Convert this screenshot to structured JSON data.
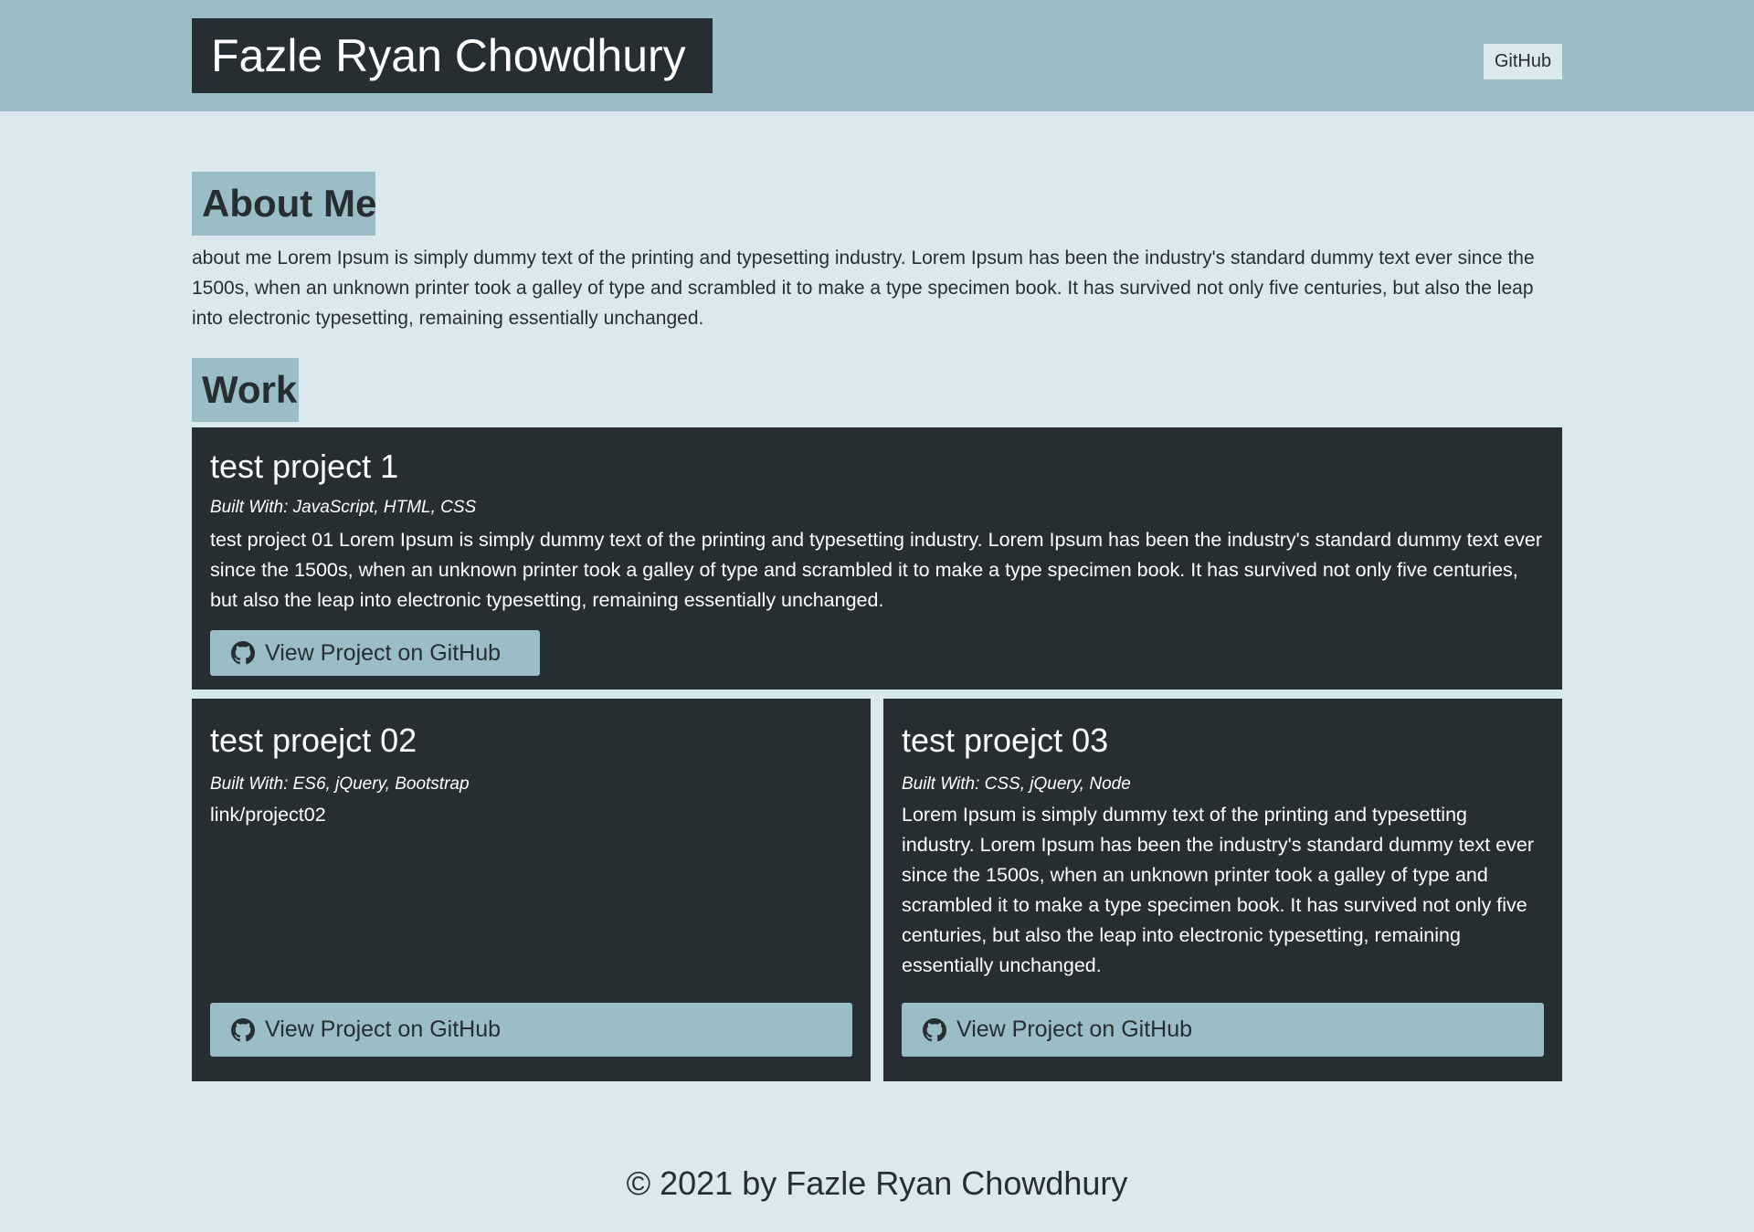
{
  "header": {
    "title": "Fazle Ryan Chowdhury",
    "nav": {
      "github_label": "GitHub"
    }
  },
  "about": {
    "heading": "About Me",
    "text": "about me Lorem Ipsum is simply dummy text of the printing and typesetting industry. Lorem Ipsum has been the industry's standard dummy text ever since the 1500s, when an unknown printer took a galley of type and scrambled it to make a type specimen book. It has survived not only five centuries, but also the leap into electronic typesetting, remaining essentially unchanged."
  },
  "work": {
    "heading": "Work",
    "projects": [
      {
        "title": "test project 1",
        "built_with": "Built With: JavaScript, HTML, CSS",
        "description": "test project 01 Lorem Ipsum is simply dummy text of the printing and typesetting industry. Lorem Ipsum has been the industry's standard dummy text ever since the 1500s, when an unknown printer took a galley of type and scrambled it to make a type specimen book. It has survived not only five centuries, but also the leap into electronic typesetting, remaining essentially unchanged.",
        "button_label": "View Project on GitHub",
        "icon": "github-icon"
      },
      {
        "title": "test proejct 02",
        "built_with": "Built With: ES6, jQuery, Bootstrap",
        "description": "link/project02",
        "button_label": "View Project on GitHub",
        "icon": "github-icon"
      },
      {
        "title": "test proejct 03",
        "built_with": "Built With: CSS, jQuery, Node",
        "description": "Lorem Ipsum is simply dummy text of the printing and typesetting industry. Lorem Ipsum has been the industry's standard dummy text ever since the 1500s, when an unknown printer took a galley of type and scrambled it to make a type specimen book. It has survived not only five centuries, but also the leap into electronic typesetting, remaining essentially unchanged.",
        "button_label": "View Project on GitHub",
        "icon": "github-icon"
      }
    ]
  },
  "footer": {
    "text": "© 2021 by Fazle Ryan Chowdhury"
  },
  "colors": {
    "page_background": "#dae9ed",
    "header_background": "#9bbdc6",
    "dark": "#272e32",
    "accent": "#9bbdc6"
  }
}
